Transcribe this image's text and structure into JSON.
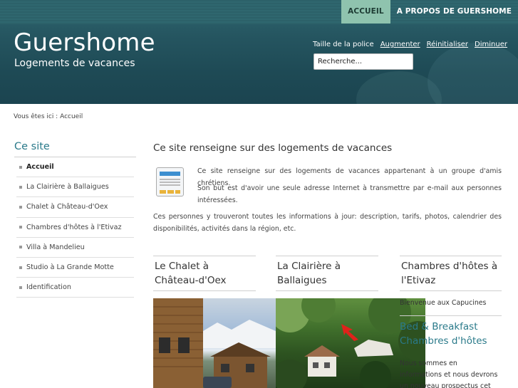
{
  "topnav": {
    "home": "ACCUEIL",
    "about": "A PROPOS DE GUERSHOME"
  },
  "site": {
    "title": "Guershome",
    "subtitle": "Logements de vacances"
  },
  "font_controls": {
    "label": "Taille de la police",
    "increase": "Augmenter",
    "reset": "Réinitialiser",
    "decrease": "Diminuer"
  },
  "search": {
    "value": "Recherche..."
  },
  "breadcrumb": "Vous êtes ici : Accueil",
  "sidebar": {
    "title": "Ce site",
    "items": [
      {
        "label": "Accueil"
      },
      {
        "label": "La Clairière à Ballaigues"
      },
      {
        "label": "Chalet à Château-d'Oex"
      },
      {
        "label": "Chambres d'hôtes à l'Etivaz"
      },
      {
        "label": "Villa à Mandelieu"
      },
      {
        "label": "Studio à La Grande Motte"
      },
      {
        "label": "Identification"
      }
    ]
  },
  "main": {
    "heading": "Ce site renseigne sur des logements de vacances",
    "p1": "Ce site renseigne sur des logements de vacances appartenant à un groupe d'amis chrétiens.",
    "p2": "Son but est d'avoir une seule adresse Internet à transmettre par e-mail aux personnes intéressées.",
    "p3": "Ces personnes y trouveront toutes les informations à jour: description, tarifs, photos, calendrier des disponibilités, activités dans la région, etc."
  },
  "columns": [
    {
      "title": "Le Chalet à Château-d'Oex"
    },
    {
      "title": "La Clairière à Ballaigues"
    },
    {
      "title": "Chambres d'hôtes à l'Etivaz"
    }
  ],
  "col3": {
    "welcome": "Bienvenue aux Capucines",
    "link": "Bed & Breakfast Chambres d'hôtes",
    "line1": "Nous sommes en",
    "line2": "informations et nous devrons",
    "line3": "un nouveau prospectus cet"
  }
}
